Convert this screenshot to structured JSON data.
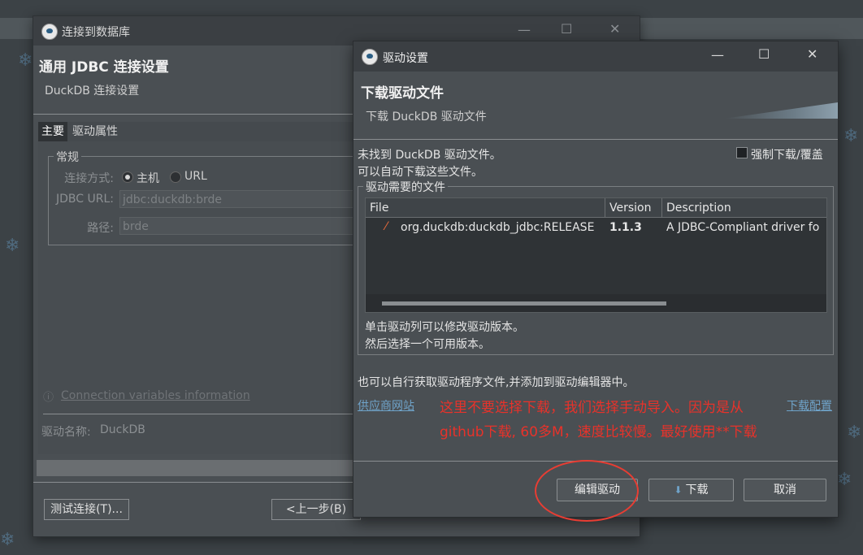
{
  "back_window": {
    "title": "连接到数据库",
    "header_title": "通用 JDBC 连接设置",
    "header_subtitle": "DuckDB 连接设置",
    "tabs": [
      {
        "label": "主要",
        "active": true
      },
      {
        "label": "驱动属性",
        "active": false
      }
    ],
    "group_title": "常规",
    "connect_mode_label": "连接方式:",
    "radio_host": "主机",
    "radio_url": "URL",
    "jdbc_url_label": "JDBC URL:",
    "jdbc_url_value": "jdbc:duckdb:brde",
    "path_label": "路径:",
    "path_value": "brde",
    "connection_vars_link": "Connection variables information",
    "driver_name_label": "驱动名称:",
    "driver_name_value": "DuckDB",
    "test_button": "测试连接(T)...",
    "prev_button": "<上一步(B)"
  },
  "dialog": {
    "title": "驱动设置",
    "header_title": "下载驱动文件",
    "header_subtitle": "下载 DuckDB 驱动文件",
    "not_found_line1": "未找到 DuckDB 驱动文件。",
    "not_found_line2": "可以自动下载这些文件。",
    "force_download_label": "强制下载/覆盖",
    "force_download_checked": false,
    "files_group_title": "驱动需要的文件",
    "table": {
      "columns": [
        "File",
        "Version",
        "Description"
      ],
      "rows": [
        {
          "file": "org.duckdb:duckdb_jdbc:RELEASE",
          "version": "1.1.3",
          "description": "A JDBC-Compliant driver fo"
        }
      ]
    },
    "hint_line1": "单击驱动列可以修改驱动版本。",
    "hint_line2": "然后选择一个可用版本。",
    "manual_hint": "也可以自行获取驱动程序文件,并添加到驱动编辑器中。",
    "vendor_link": "供应商网站",
    "download_config_link": "下载配置",
    "buttons": {
      "edit_driver": "编辑驱动",
      "download": "下载",
      "cancel": "取消"
    }
  },
  "annotation": {
    "line1": "这里不要选择下载，我们选择手动导入。因为是从",
    "line2": "github下载, 60多M，速度比较慢。最好使用**下载",
    "color": "#e8322a"
  }
}
